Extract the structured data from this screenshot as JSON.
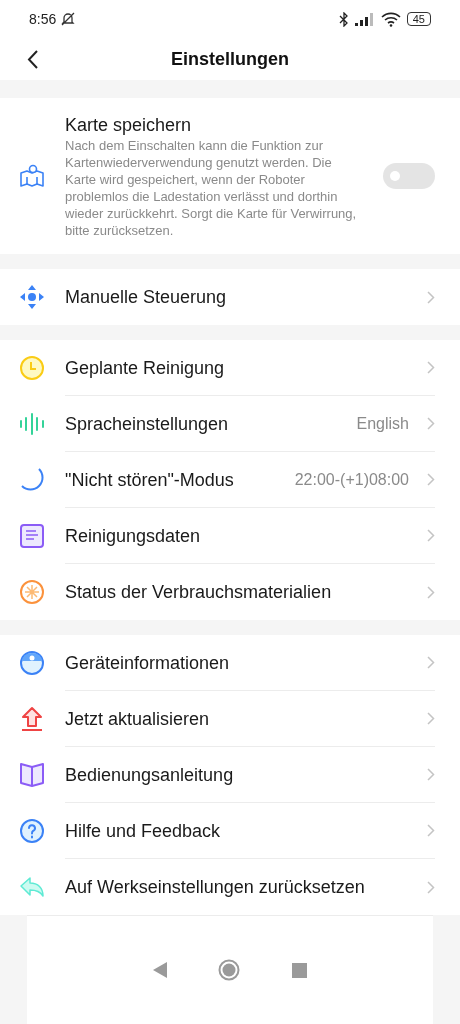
{
  "status_bar": {
    "time": "8:56",
    "battery": "45"
  },
  "header": {
    "title": "Einstellungen"
  },
  "map_setting": {
    "title": "Karte speichern",
    "description": "Nach dem Einschalten kann die Funktion zur Kartenwiederverwendung genutzt werden. Die Karte wird gespeichert, wenn der Roboter problemlos die Ladestation verlässt und dorthin wieder zurückkehrt. Sorgt die Karte für Verwirrung, bitte zurücksetzen.",
    "on": false
  },
  "groups": [
    {
      "items": [
        {
          "kind": "move",
          "label": "Manuelle Steuerung"
        }
      ]
    },
    {
      "items": [
        {
          "kind": "clock",
          "label": "Geplante Reinigung"
        },
        {
          "kind": "voice",
          "label": "Spracheinstellungen",
          "value": "English"
        },
        {
          "kind": "moon",
          "label": "\"Nicht stören\"-Modus",
          "value": "22:00-(+1)08:00"
        },
        {
          "kind": "doc",
          "label": "Reinigungsdaten"
        },
        {
          "kind": "brush",
          "label": "Status der Verbrauchsmaterialien"
        }
      ]
    },
    {
      "items": [
        {
          "kind": "robot",
          "label": "Geräteinformationen"
        },
        {
          "kind": "upgrade",
          "label": "Jetzt aktualisieren"
        },
        {
          "kind": "book",
          "label": "Bedienungsanleitung"
        },
        {
          "kind": "help",
          "label": "Hilfe und Feedback"
        },
        {
          "kind": "reset",
          "label": "Auf Werkseinstellungen zurücksetzen"
        }
      ]
    }
  ]
}
